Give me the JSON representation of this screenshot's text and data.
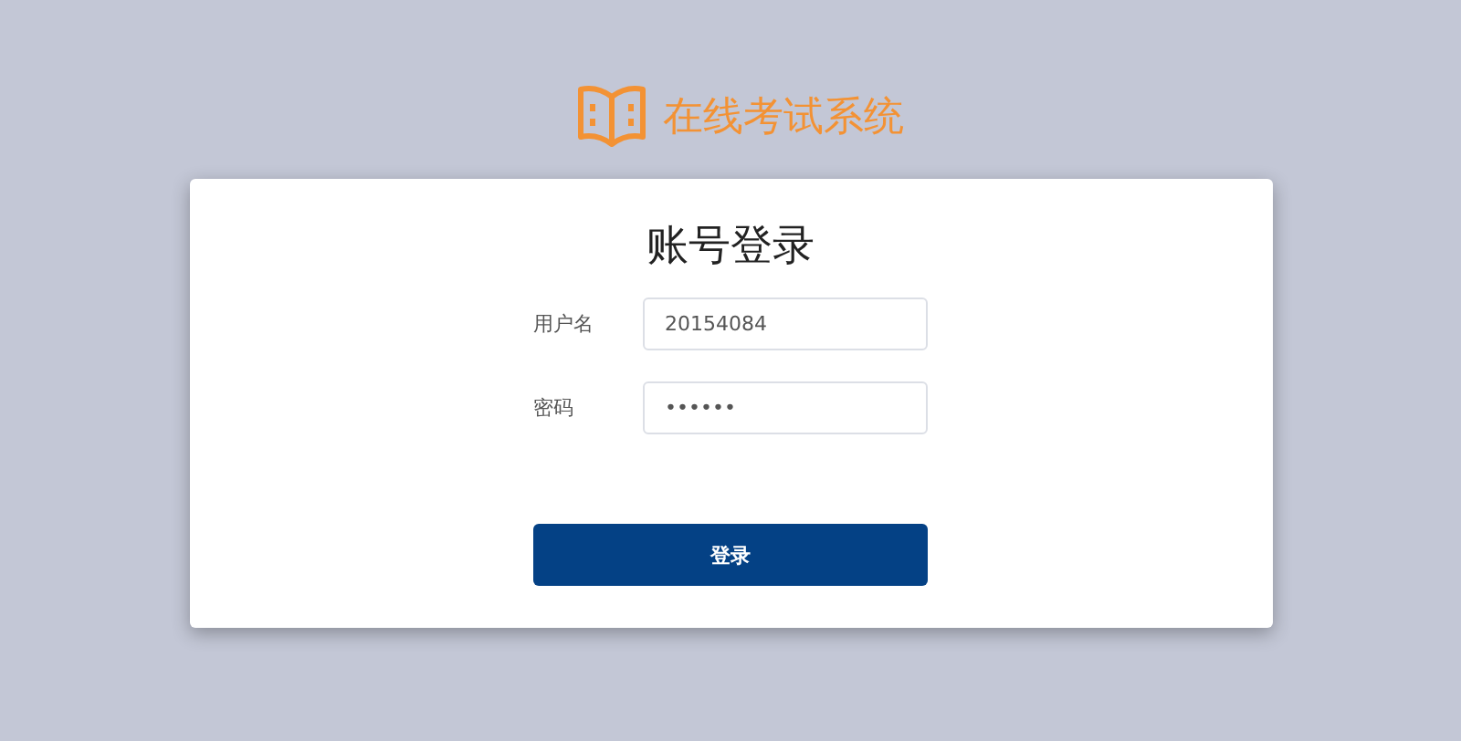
{
  "brand": {
    "title": "在线考试系统"
  },
  "login": {
    "heading": "账号登录",
    "fields": [
      {
        "label": "用户名",
        "value": "20154084"
      },
      {
        "label": "密码",
        "value": "••••••"
      }
    ],
    "submit": "登录"
  }
}
